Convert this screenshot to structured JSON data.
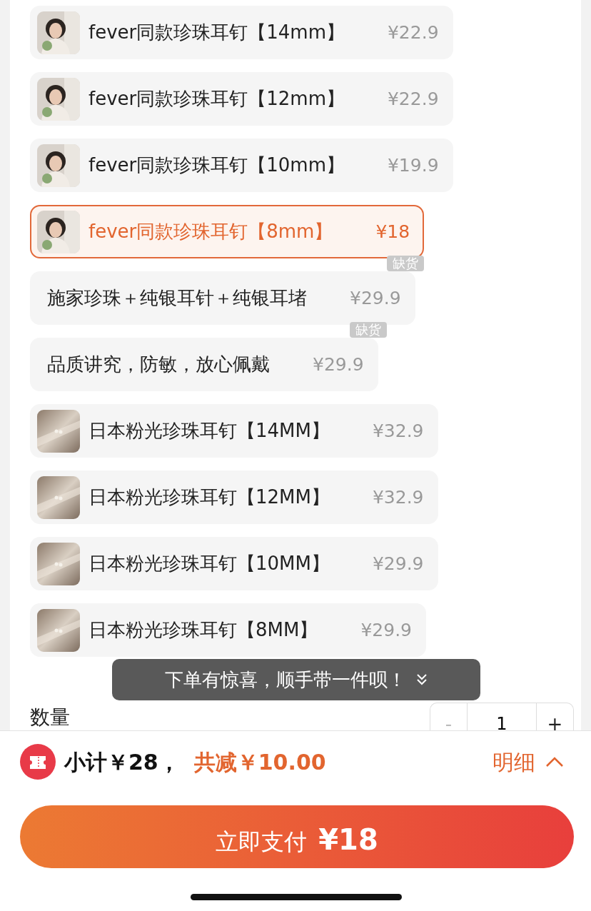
{
  "options": [
    {
      "kind": "portrait",
      "name": "fever同款珍珠耳钉【14mm】",
      "price": "¥22.9",
      "selected": false
    },
    {
      "kind": "portrait",
      "name": "fever同款珍珠耳钉【12mm】",
      "price": "¥22.9",
      "selected": false
    },
    {
      "kind": "portrait",
      "name": "fever同款珍珠耳钉【10mm】",
      "price": "¥19.9",
      "selected": false
    },
    {
      "kind": "portrait",
      "name": "fever同款珍珠耳钉【8mm】",
      "price": "¥18",
      "selected": true
    },
    {
      "kind": "text",
      "name": "施家珍珠＋纯银耳针＋纯银耳堵",
      "price": "¥29.9",
      "selected": false,
      "badge": "缺货"
    },
    {
      "kind": "text",
      "name": "品质讲究，防敏，放心佩戴",
      "price": "¥29.9",
      "selected": false,
      "badge": "缺货"
    },
    {
      "kind": "product",
      "name": "日本粉光珍珠耳钉【14MM】",
      "price": "¥32.9",
      "selected": false
    },
    {
      "kind": "product",
      "name": "日本粉光珍珠耳钉【12MM】",
      "price": "¥32.9",
      "selected": false
    },
    {
      "kind": "product",
      "name": "日本粉光珍珠耳钉【10MM】",
      "price": "¥29.9",
      "selected": false
    },
    {
      "kind": "product",
      "name": "日本粉光珍珠耳钉【8MM】",
      "price": "¥29.9",
      "selected": false
    }
  ],
  "toast": {
    "text": "下单有惊喜，顺手带一件呗！"
  },
  "quantity": {
    "label": "数量",
    "minus": "-",
    "value": "1",
    "plus": "+",
    "minus_disabled": true
  },
  "summary": {
    "subtotal": "小计￥28，",
    "discount": "共减￥10.00",
    "details": "明细"
  },
  "pay_button": {
    "label": "立即支付",
    "amount": "¥18"
  }
}
